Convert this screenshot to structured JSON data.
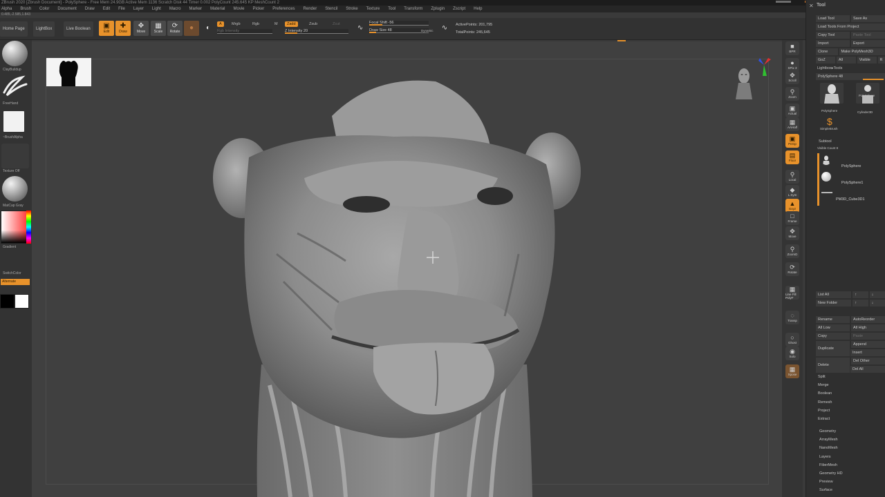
{
  "window": {
    "title_text": "ZBrush 2020  [Zbrush Document]  -  PolySphere  -  Free Mem 24.9GB  Active Mem 1136  Scratch Disk 44  Timer 0.002  PolyCount 245.645 KP  MeshCount 2",
    "coords": "0.485,-2.585,1.843"
  },
  "menu": [
    "Alpha",
    "Brush",
    "Color",
    "Document",
    "Draw",
    "Edit",
    "File",
    "Layer",
    "Light",
    "Macro",
    "Marker",
    "Material",
    "Movie",
    "Picker",
    "Preferences",
    "Render",
    "Stencil",
    "Stroke",
    "Texture",
    "Tool",
    "Transform",
    "Zplugin",
    "Zscript",
    "Help"
  ],
  "shelf": {
    "home_page": "Home Page",
    "lightbox": "LightBox",
    "live_boolean": "Live Boolean",
    "edit": "Edit",
    "draw": "Draw",
    "move": "Move",
    "scale": "Scale",
    "rotate": "Rotate",
    "a": "A",
    "mrgb": "Mrgb",
    "rgb": "Rgb",
    "m": "M",
    "zadd": "Zadd",
    "zsub": "Zsub",
    "zcut": "Zcut",
    "rgb_intensity": "Rgb Intensity",
    "z_intensity": "Z Intensity 20",
    "z_intensity_value": 20,
    "focal_shift": "Focal Shift -56",
    "focal_shift_value": -56,
    "draw_size": "Draw Size 48",
    "draw_size_value": 48,
    "dynamic": "Dynamic",
    "active_points": "ActivePoints: 201,795",
    "total_points": "TotalPoints: 245,645"
  },
  "left_tray": {
    "brush": "ClayBuildup",
    "stroke": "FreeHand",
    "alpha": "~BrushAlpha",
    "texture": "Texture Off",
    "material": "MatCap Gray",
    "gradient": "Gradient",
    "switch_color": "SwitchColor",
    "alternate": "Alternate",
    "main_color": "#000000",
    "secondary_color": "#ffffff"
  },
  "right_bar": [
    {
      "name": "bpr",
      "label": "BPR"
    },
    {
      "name": "spix",
      "label": "SPix 3"
    },
    {
      "name": "scroll",
      "label": "Scroll"
    },
    {
      "name": "zoom",
      "label": "Zoom"
    },
    {
      "name": "actual",
      "label": "Actual"
    },
    {
      "name": "aahalf",
      "label": "AAHalf"
    },
    {
      "name": "persp",
      "label": "Persp"
    },
    {
      "name": "floor",
      "label": "Floor"
    },
    {
      "name": "local",
      "label": "Local"
    },
    {
      "name": "lsym",
      "label": "L.Sym"
    },
    {
      "name": "gxyz",
      "label": "Gxyz"
    },
    {
      "name": "frame",
      "label": "Frame"
    },
    {
      "name": "move",
      "label": "Move"
    },
    {
      "name": "zoom3d",
      "label": "ZoomD"
    },
    {
      "name": "rotate",
      "label": "Rotate"
    },
    {
      "name": "linefill",
      "label": "Line Fill PolyF"
    },
    {
      "name": "transp",
      "label": "Transp"
    },
    {
      "name": "ghost",
      "label": "Ghost"
    },
    {
      "name": "solo",
      "label": "Solo"
    },
    {
      "name": "xpose",
      "label": "Xpose"
    }
  ],
  "tool": {
    "title": "Tool",
    "load_tool": "Load Tool",
    "save_as": "Save As",
    "load_from_project": "Load Tools From Project",
    "copy_tool": "Copy Tool",
    "paste_tool": "Paste Tool",
    "import": "Import",
    "export": "Export",
    "clone": "Clone",
    "make_polymesh": "Make PolyMesh3D",
    "goz": "GoZ",
    "all": "All",
    "visible": "Visible",
    "r": "R",
    "lightbox_tools": "Lightbox▸Tools",
    "current_tool": "PolySphere",
    "current_tool_value": "48",
    "thumbs": [
      "PolySphere",
      "PolySphere",
      "Cylinder3D",
      "SimpleBrush"
    ],
    "subtool_title": "Subtool",
    "visible_count": "Visible Count 8",
    "subtools": [
      "PolySphere",
      "PolySphere1",
      "PM3D_Cube3D1"
    ],
    "list_all": "List All",
    "new_folder": "New Folder",
    "rename": "Rename",
    "auto_reorder": "AutoReorder",
    "all_low": "All Low",
    "all_high": "All High",
    "copy": "Copy",
    "paste": "Paste",
    "duplicate": "Duplicate",
    "append": "Append",
    "insert": "Insert",
    "delete": "Delete",
    "del_other": "Del Other",
    "del_all": "Del All",
    "sections": [
      "Split",
      "Merge",
      "Boolean",
      "Remesh",
      "Project",
      "Extract"
    ],
    "palettes": [
      "Geometry",
      "ArrayMesh",
      "NanoMesh",
      "Layers",
      "FiberMesh",
      "Geometry HD",
      "Preview",
      "Surface"
    ]
  }
}
